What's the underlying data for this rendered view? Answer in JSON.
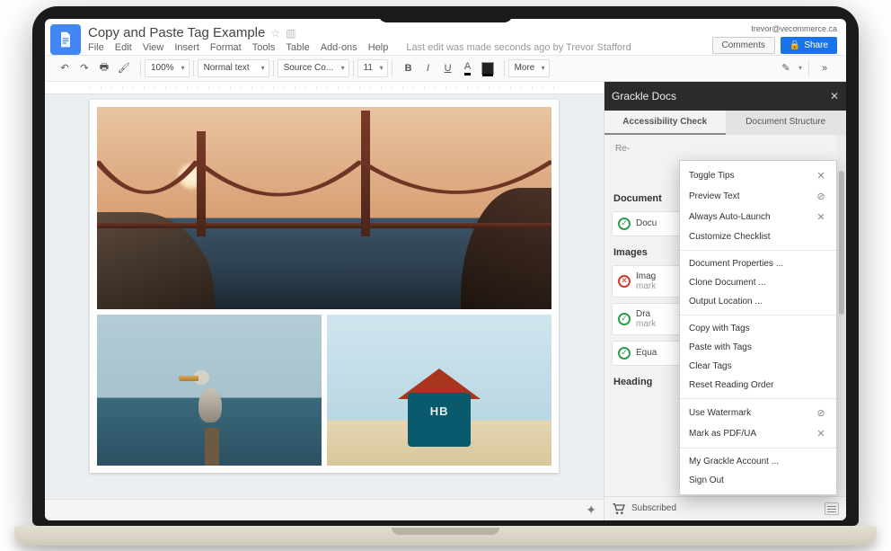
{
  "header": {
    "doc_title": "Copy and Paste Tag Example",
    "user_email": "trevor@vecommerce.ca",
    "edit_info": "Last edit was made seconds ago by Trevor Stafford",
    "comments_label": "Comments",
    "share_label": "Share"
  },
  "menu": {
    "items": [
      "File",
      "Edit",
      "View",
      "Insert",
      "Format",
      "Tools",
      "Table",
      "Add-ons",
      "Help"
    ]
  },
  "toolbar": {
    "zoom": "100%",
    "style": "Normal text",
    "font": "Source Co...",
    "size": "11",
    "more": "More"
  },
  "sidebar": {
    "title": "Grackle Docs",
    "tabs": {
      "a11y": "Accessibility Check",
      "structure": "Document Structure"
    },
    "recheck": "Re-",
    "sections": {
      "document": {
        "title": "Document",
        "items": [
          {
            "status": "pass",
            "label": "Docu"
          }
        ]
      },
      "images": {
        "title": "Images",
        "items": [
          {
            "status": "fail",
            "label": "Imag",
            "sub": "mark"
          },
          {
            "status": "pass",
            "label": "Dra",
            "sub": "mark"
          },
          {
            "status": "pass",
            "label": "Equa"
          }
        ]
      },
      "headings": {
        "title": "Heading"
      }
    },
    "footer": {
      "subscribed": "Subscribed"
    }
  },
  "dropdown": {
    "groups": [
      [
        {
          "label": "Toggle Tips",
          "icon": "✕"
        },
        {
          "label": "Preview Text",
          "icon": "⊘"
        },
        {
          "label": "Always Auto-Launch",
          "icon": "✕"
        },
        {
          "label": "Customize Checklist",
          "icon": ""
        }
      ],
      [
        {
          "label": "Document Properties ...",
          "icon": ""
        },
        {
          "label": "Clone Document ...",
          "icon": ""
        },
        {
          "label": "Output Location ...",
          "icon": ""
        }
      ],
      [
        {
          "label": "Copy with Tags",
          "icon": ""
        },
        {
          "label": "Paste with Tags",
          "icon": ""
        },
        {
          "label": "Clear Tags",
          "icon": ""
        },
        {
          "label": "Reset Reading Order",
          "icon": ""
        }
      ],
      [
        {
          "label": "Use Watermark",
          "icon": "⊘"
        },
        {
          "label": "Mark as PDF/UA",
          "icon": "✕"
        }
      ],
      [
        {
          "label": "My Grackle Account ...",
          "icon": ""
        },
        {
          "label": "Sign Out",
          "icon": ""
        }
      ]
    ]
  },
  "images": {
    "tower_sign": "HB"
  }
}
